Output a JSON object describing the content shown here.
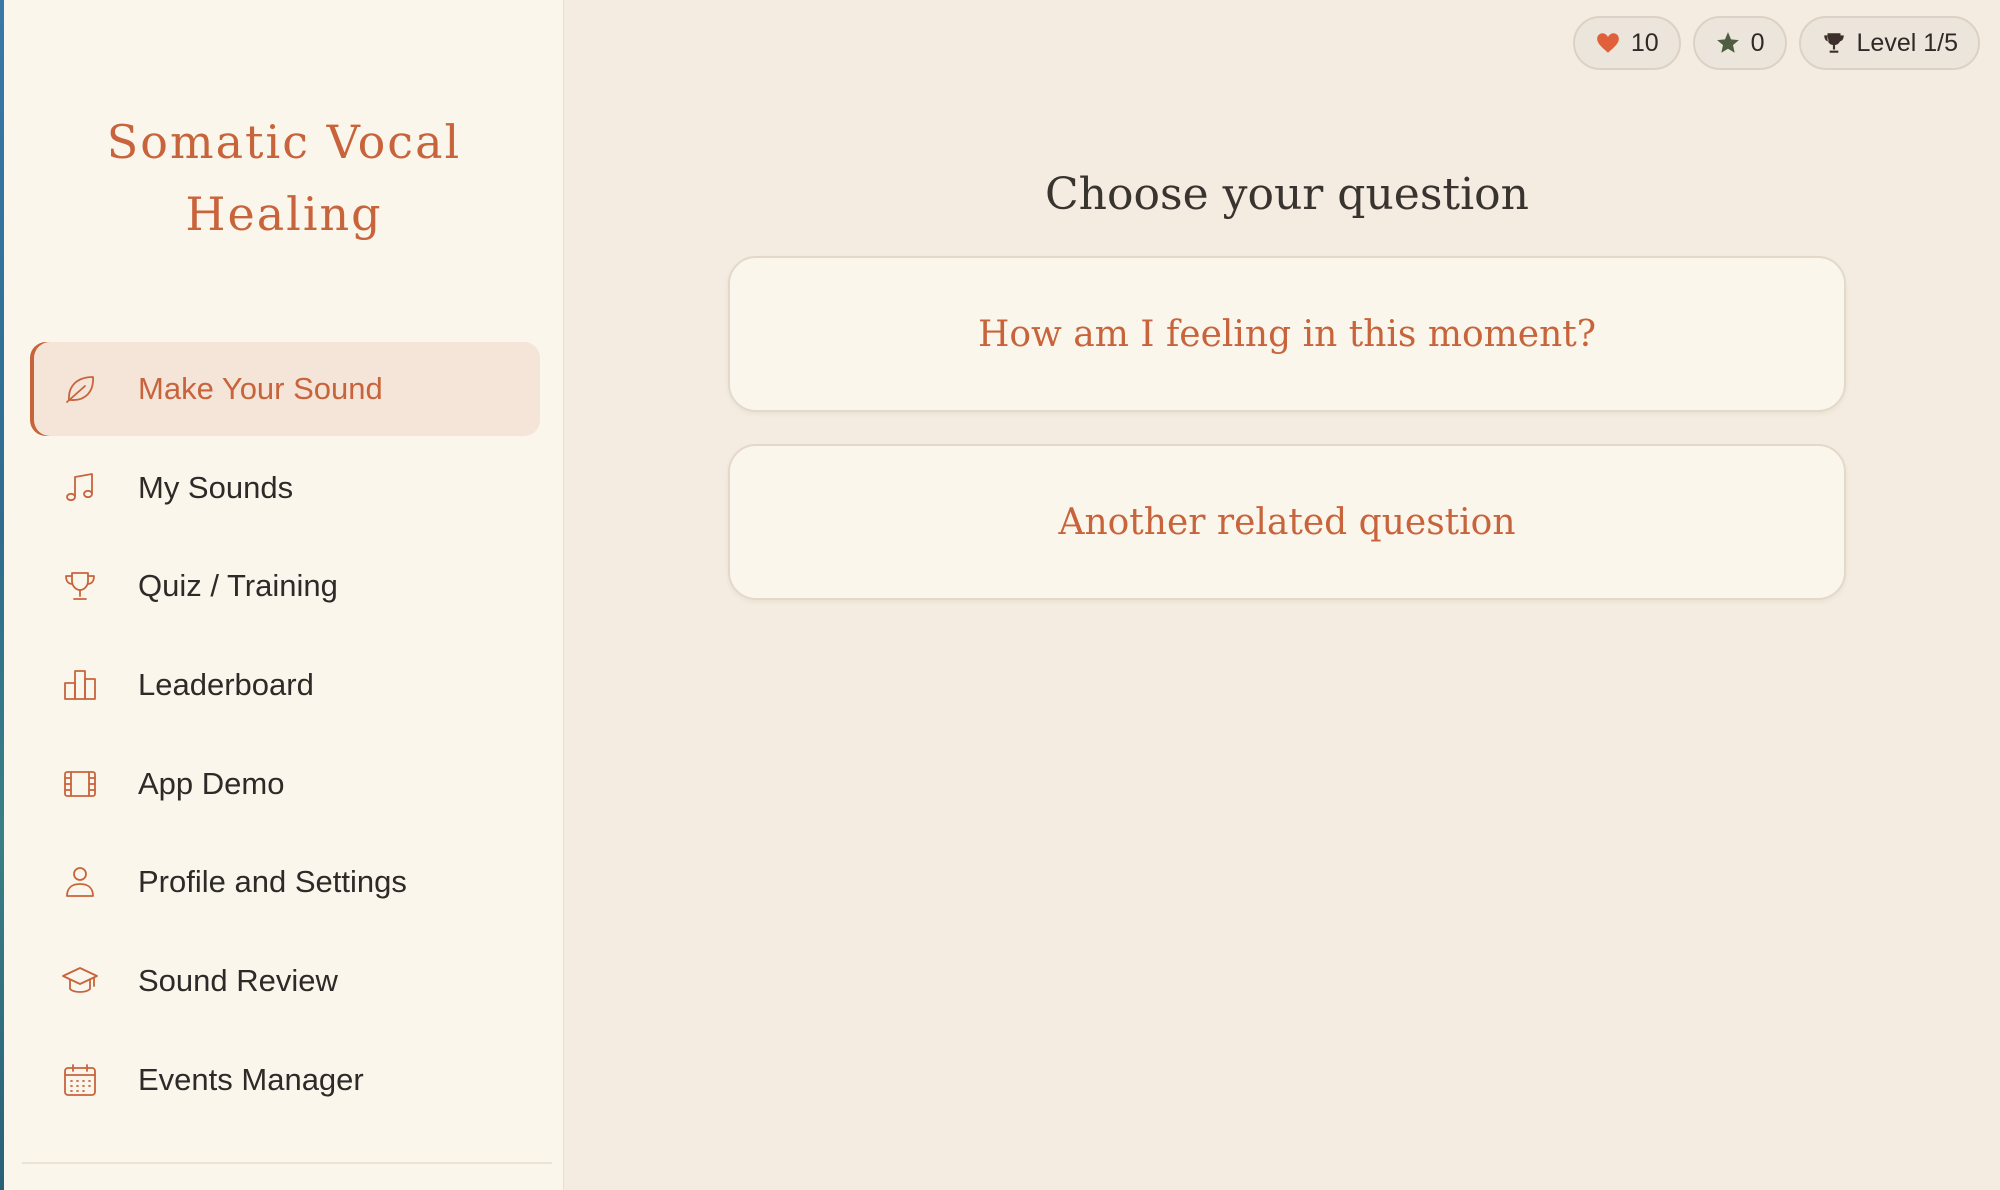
{
  "app": {
    "brand_line1": "Somatic Vocal",
    "brand_line2": "Healing"
  },
  "nav": [
    {
      "label": "Make Your Sound",
      "icon": "leaf-icon",
      "active": true
    },
    {
      "label": "My Sounds",
      "icon": "music-note-icon"
    },
    {
      "label": "Quiz / Training",
      "icon": "trophy-icon"
    },
    {
      "label": "Leaderboard",
      "icon": "bar-chart-icon"
    },
    {
      "label": "App Demo",
      "icon": "film-icon"
    },
    {
      "label": "Profile and Settings",
      "icon": "user-icon"
    },
    {
      "label": "Sound Review",
      "icon": "graduation-cap-icon"
    },
    {
      "label": "Events Manager",
      "icon": "calendar-icon"
    }
  ],
  "stats": {
    "hearts": "10",
    "stars": "0",
    "level": "Level 1/5",
    "heart_color": "#e0603c",
    "star_color": "#4f5e42",
    "trophy_color": "#3c2f2c"
  },
  "main": {
    "title": "Choose your question",
    "questions": [
      "How am I feeling in this moment?",
      "Another related question"
    ]
  },
  "colors": {
    "accent": "#c8643c",
    "sidebar_bg": "#fbf6ec",
    "main_bg": "#f4ece0"
  }
}
